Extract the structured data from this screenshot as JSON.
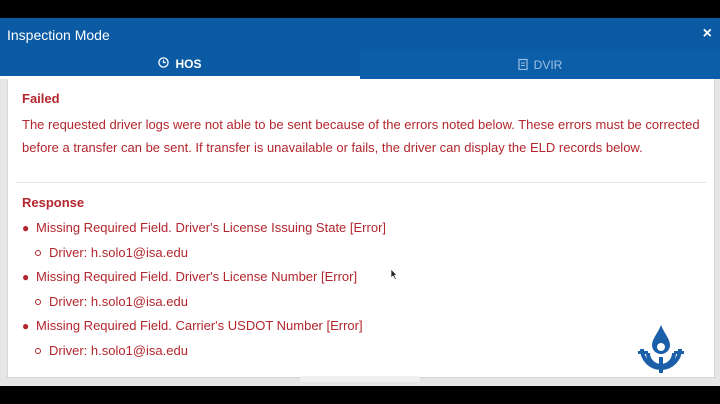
{
  "window": {
    "title": "Inspection Mode",
    "close_glyph": "×"
  },
  "tabs": [
    {
      "label": "HOS",
      "icon": "clock-icon",
      "active": true
    },
    {
      "label": "DVIR",
      "icon": "clipboard-icon",
      "active": false
    }
  ],
  "failed": {
    "title": "Failed",
    "message": "The requested driver logs were not able to be sent because of the errors noted below. These errors must be corrected before a transfer can be sent. If transfer is unavailable or fails, the driver can display the ELD records below."
  },
  "response": {
    "title": "Response",
    "errors": [
      {
        "text": "Missing Required Field. Driver's License Issuing State [Error]",
        "driver": "Driver: h.solo1@isa.edu"
      },
      {
        "text": "Missing Required Field. Driver's License Number [Error]",
        "driver": "Driver: h.solo1@isa.edu"
      },
      {
        "text": "Missing Required Field. Carrier's USDOT Number [Error]",
        "driver": "Driver: h.solo1@isa.edu"
      }
    ]
  },
  "colors": {
    "header_blue": "#0a5aa4",
    "error_red": "#b3262d",
    "logo_blue": "#1a5fa8"
  }
}
